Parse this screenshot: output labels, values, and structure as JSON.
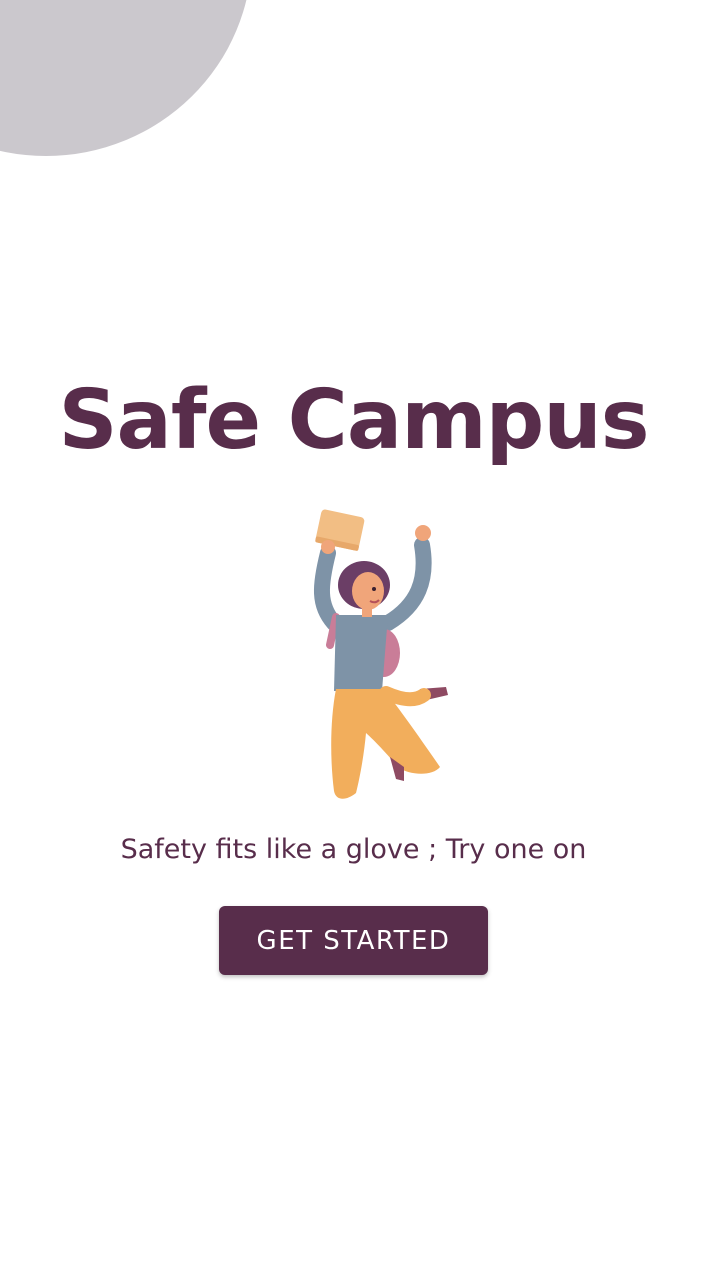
{
  "app": {
    "title": "Safe Campus",
    "tagline": "Safety fits like a glove ; Try one on"
  },
  "actions": {
    "get_started_label": "GET STARTED"
  },
  "colors": {
    "brand": "#582d4b",
    "background": "#ffffff",
    "corner_shape": "#cbc8cd"
  },
  "illustration": {
    "icon": "jumping-student-illustration"
  }
}
